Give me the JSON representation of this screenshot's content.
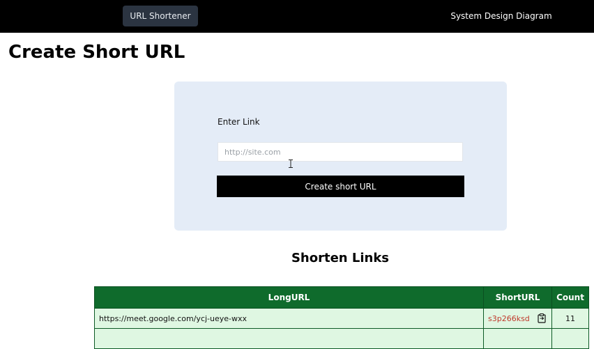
{
  "nav": {
    "brand_label": "URL Shortener",
    "diagram_link": "System Design Diagram"
  },
  "page": {
    "title": "Create Short URL"
  },
  "form": {
    "label": "Enter Link",
    "input_value": "",
    "input_placeholder": "http://site.com",
    "submit_label": "Create short URL"
  },
  "links": {
    "title": "Shorten Links",
    "columns": [
      "LongURL",
      "ShortURL",
      "Count"
    ],
    "rows": [
      {
        "long_url": "https://meet.google.com/ycj-ueye-wxx",
        "short_url": "s3p266ksd",
        "count": "11"
      },
      {
        "long_url": "",
        "short_url": "",
        "count": ""
      }
    ]
  },
  "icons": {
    "copy": "copy-icon",
    "cursor": "text-cursor-icon"
  },
  "colors": {
    "navbar": "#000000",
    "nav_active": "#2b3441",
    "card": "#e4ecf7",
    "button": "#000000",
    "table_header": "#0f6b2c",
    "table_row": "#dff7e2",
    "short_link": "#c0392b"
  }
}
